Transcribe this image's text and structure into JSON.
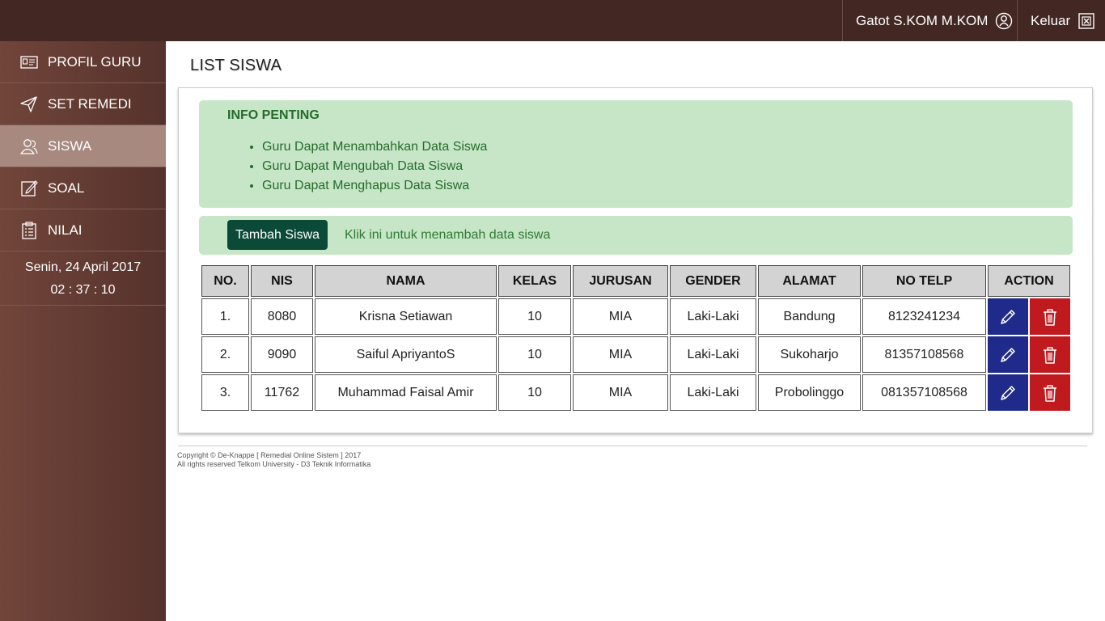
{
  "topbar": {
    "user_name": "Gatot S.KOM M.KOM",
    "logout_label": "Keluar"
  },
  "sidebar": {
    "items": [
      {
        "label": "PROFIL GURU",
        "icon": "id-card-icon",
        "active": false
      },
      {
        "label": "SET REMEDI",
        "icon": "paper-plane-icon",
        "active": false
      },
      {
        "label": "SISWA",
        "icon": "users-icon",
        "active": true
      },
      {
        "label": "SOAL",
        "icon": "edit-icon",
        "active": false
      },
      {
        "label": "NILAI",
        "icon": "clipboard-icon",
        "active": false
      }
    ],
    "date": "Senin, 24 April 2017",
    "time": "02 : 37 : 10"
  },
  "page": {
    "title": "LIST SISWA"
  },
  "info": {
    "title": "INFO PENTING",
    "items": [
      "Guru Dapat Menambahkan Data Siswa",
      "Guru Dapat Mengubah Data Siswa",
      "Guru Dapat Menghapus Data Siswa"
    ]
  },
  "add": {
    "button_label": "Tambah Siswa",
    "hint": "Klik ini untuk menambah data siswa"
  },
  "table": {
    "headers": [
      "NO.",
      "NIS",
      "NAMA",
      "KELAS",
      "JURUSAN",
      "GENDER",
      "ALAMAT",
      "NO TELP",
      "ACTION"
    ],
    "rows": [
      {
        "no": "1.",
        "nis": "8080",
        "nama": "Krisna Setiawan",
        "kelas": "10",
        "jurusan": "MIA",
        "gender": "Laki-Laki",
        "alamat": "Bandung",
        "telp": "8123241234"
      },
      {
        "no": "2.",
        "nis": "9090",
        "nama": "Saiful ApriyantoS",
        "kelas": "10",
        "jurusan": "MIA",
        "gender": "Laki-Laki",
        "alamat": "Sukoharjo",
        "telp": "81357108568"
      },
      {
        "no": "3.",
        "nis": "11762",
        "nama": "Muhammad Faisal Amir",
        "kelas": "10",
        "jurusan": "MIA",
        "gender": "Laki-Laki",
        "alamat": "Probolinggo",
        "telp": "081357108568"
      }
    ]
  },
  "footer": {
    "line1": "Copyright © De-Knappe [ Remedial Online Sistem ] 2017",
    "line2": "All rights reserved Telkom University - D3 Teknik Informatika"
  },
  "colors": {
    "topbar": "#432723",
    "sidebar_active": "#a88980",
    "info_bg": "#c7e6c8",
    "add_button": "#0b4a37",
    "edit_button": "#1f2a8a",
    "delete_button": "#c0191e"
  }
}
